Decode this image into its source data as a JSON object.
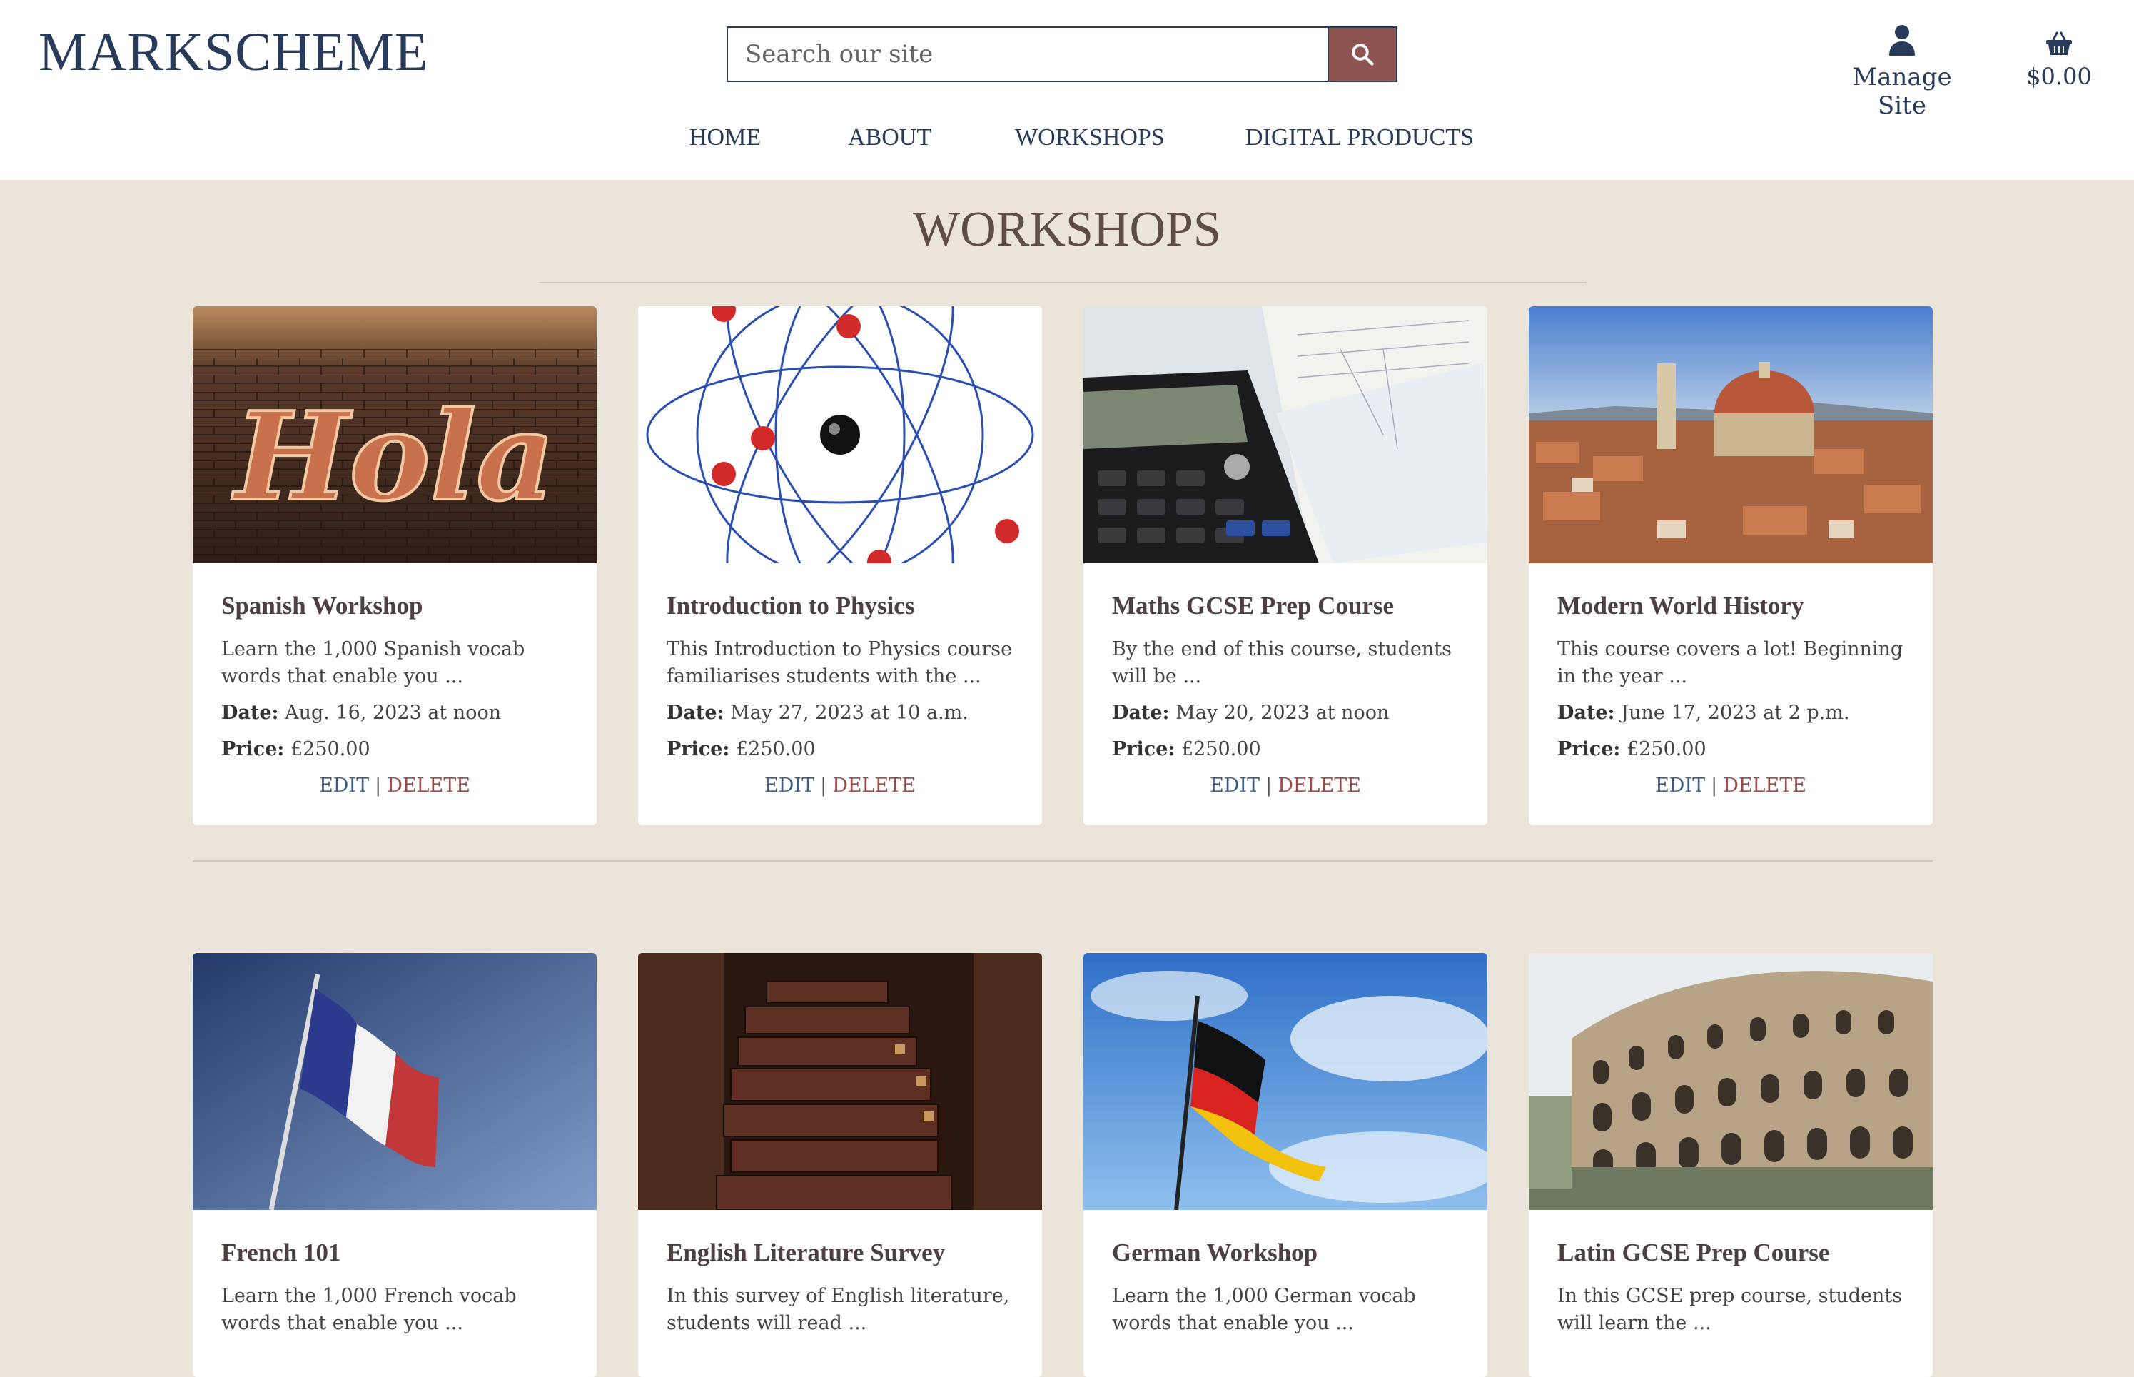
{
  "header": {
    "logo": "MARKSCHEME",
    "search_placeholder": "Search our site",
    "manage_label": "Manage Site",
    "cart_total": "$0.00"
  },
  "nav": [
    "HOME",
    "ABOUT",
    "WORKSHOPS",
    "DIGITAL PRODUCTS"
  ],
  "page_title": "WORKSHOPS",
  "labels": {
    "date": "Date:",
    "price": "Price:",
    "edit": "EDIT",
    "delete": "DELETE",
    "sep": "|"
  },
  "workshops": [
    {
      "title": "Spanish Workshop",
      "desc": "Learn the 1,000 Spanish vocab words that enable you ...",
      "date": "Aug. 16, 2023 at noon",
      "price": "£250.00",
      "image": "hola-marquee-sign"
    },
    {
      "title": "Introduction to Physics",
      "desc": "This Introduction to Physics course familiarises students with the ...",
      "date": "May 27, 2023 at 10 a.m.",
      "price": "£250.00",
      "image": "atom-diagram"
    },
    {
      "title": "Maths GCSE Prep Course",
      "desc": "By the end of this course, students will be ...",
      "date": "May 20, 2023 at noon",
      "price": "£250.00",
      "image": "calculator-worksheet"
    },
    {
      "title": "Modern World History",
      "desc": "This course covers a lot! Beginning in the year ...",
      "date": "June 17, 2023 at 2 p.m.",
      "price": "£250.00",
      "image": "florence-cityscape"
    },
    {
      "title": "French 101",
      "desc": "Learn the 1,000 French vocab words that enable you ...",
      "image": "french-flag"
    },
    {
      "title": "English Literature Survey",
      "desc": "In this survey of English literature, students will read ...",
      "image": "old-books-stack"
    },
    {
      "title": "German Workshop",
      "desc": "Learn the 1,000 German vocab words that enable you ...",
      "image": "german-flag"
    },
    {
      "title": "Latin GCSE Prep Course",
      "desc": "In this GCSE prep course, students will learn the ...",
      "image": "colosseum"
    }
  ]
}
